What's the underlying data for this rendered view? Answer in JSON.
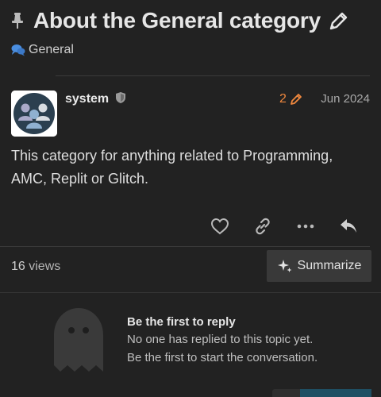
{
  "topic": {
    "title": "About the General category",
    "category": "General"
  },
  "post": {
    "username": "system",
    "edit_count": "2",
    "date": "Jun 2024",
    "body": "This category for anything related to Programming, AMC, Replit or Glitch."
  },
  "actions": {
    "icons": [
      "heart-icon",
      "link-icon",
      "more-icon",
      "reply-icon"
    ]
  },
  "stats": {
    "views_count": "16",
    "views_label": "views",
    "summarize_label": "Summarize"
  },
  "empty_state": {
    "heading": "Be the first to reply",
    "line1": "No one has replied to this topic yet.",
    "line2": "Be the first to start the conversation."
  },
  "colors": {
    "background": "#222222",
    "accent_orange": "#f0883e",
    "button_bg": "#393939"
  }
}
